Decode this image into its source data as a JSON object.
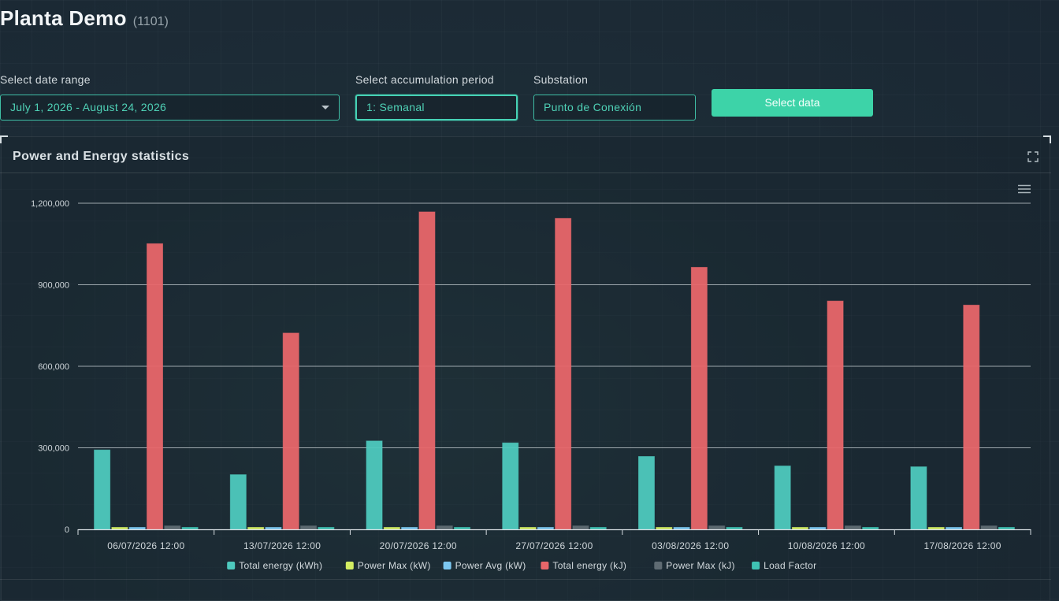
{
  "header": {
    "title": "Planta Demo",
    "code": "(1101)"
  },
  "controls": {
    "date_range_label": "Select date range",
    "date_range_value": "July 1, 2026 - August 24, 2026",
    "period_label": "Select accumulation period",
    "period_value": "1: Semanal",
    "substation_label": "Substation",
    "substation_value": "Punto de Conexión",
    "select_button": "Select data"
  },
  "panel": {
    "title": "Power and Energy statistics"
  },
  "chart_data": {
    "type": "bar",
    "categories": [
      "06/07/2026 12:00",
      "13/07/2026 12:00",
      "20/07/2026 12:00",
      "27/07/2026 12:00",
      "03/08/2026 12:00",
      "10/08/2026 12:00",
      "17/08/2026 12:00"
    ],
    "ylim": [
      0,
      1200000
    ],
    "yticks": [
      "0",
      "300,000",
      "600,000",
      "900,000",
      "1,200,000"
    ],
    "ytick_values": [
      0,
      300000,
      600000,
      900000,
      1200000
    ],
    "legend_position": "bottom-center",
    "grid": true,
    "series": [
      {
        "name": "Total energy (kWh)",
        "color": "#4ec9be",
        "values": [
          292000,
          201000,
          325000,
          318000,
          268000,
          233000,
          230000
        ]
      },
      {
        "name": "Power Max (kW)",
        "color": "#d4ee62",
        "values": [
          3500,
          3500,
          3500,
          3500,
          3500,
          3500,
          3500
        ]
      },
      {
        "name": "Power Avg (kW)",
        "color": "#7cc8f2",
        "values": [
          1800,
          1200,
          2000,
          1900,
          1600,
          1400,
          1400
        ]
      },
      {
        "name": "Total energy (kJ)",
        "color": "#e8666a",
        "values": [
          1051000,
          722000,
          1168000,
          1144000,
          964000,
          840000,
          825000
        ]
      },
      {
        "name": "Power Max (kJ)",
        "color": "#5f6b73",
        "values": [
          12600,
          12600,
          12600,
          12600,
          12600,
          12600,
          12600
        ]
      },
      {
        "name": "Load Factor",
        "color": "#3fc3b4",
        "values": [
          0.52,
          0.36,
          0.57,
          0.56,
          0.47,
          0.41,
          0.41
        ]
      }
    ]
  }
}
